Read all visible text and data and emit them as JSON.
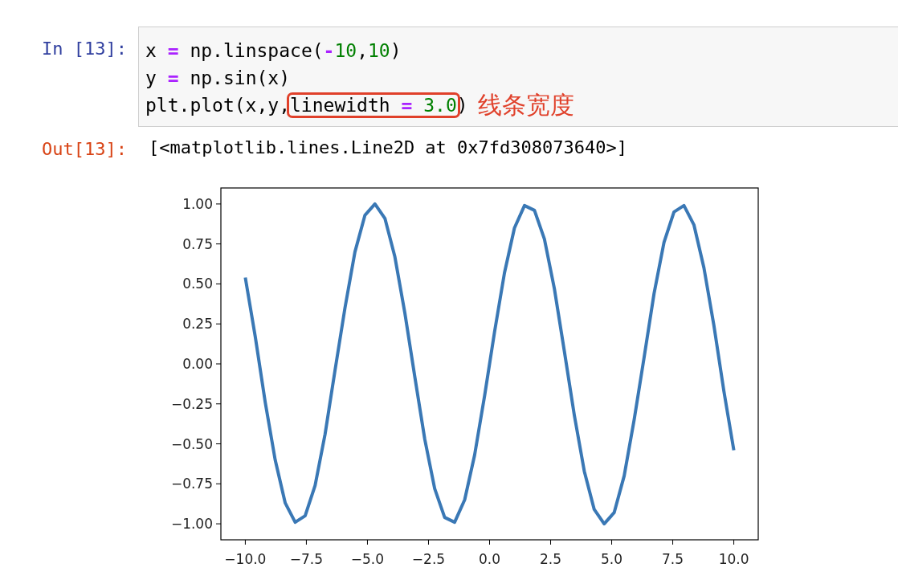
{
  "input_prompt": "In [13]:",
  "code_lines": [
    [
      {
        "kind": "text",
        "text": "x ",
        "boxed": false
      },
      {
        "kind": "op",
        "text": "=",
        "boxed": false
      },
      {
        "kind": "text",
        "text": " np.linspace(",
        "boxed": false
      },
      {
        "kind": "op",
        "text": "-",
        "boxed": false
      },
      {
        "kind": "num",
        "text": "10",
        "boxed": false
      },
      {
        "kind": "text",
        "text": ",",
        "boxed": false
      },
      {
        "kind": "num",
        "text": "10",
        "boxed": false
      },
      {
        "kind": "text",
        "text": ")",
        "boxed": false
      }
    ],
    [
      {
        "kind": "text",
        "text": "y ",
        "boxed": false
      },
      {
        "kind": "op",
        "text": "=",
        "boxed": false
      },
      {
        "kind": "text",
        "text": " np.sin(x)",
        "boxed": false
      }
    ],
    [
      {
        "kind": "text",
        "text": "plt.plot(x,y,",
        "boxed": false
      },
      {
        "kind": "text",
        "text": "linewidth ",
        "boxed": true
      },
      {
        "kind": "op",
        "text": "=",
        "boxed": true
      },
      {
        "kind": "num",
        "text": " 3.0",
        "boxed": true
      },
      {
        "kind": "text",
        "text": ")",
        "boxed": false
      }
    ]
  ],
  "annotation": {
    "text": "线条宽度"
  },
  "output_prompt": "Out[13]:",
  "output_text": "[<matplotlib.lines.Line2D at 0x7fd308073640>]",
  "chart_data": {
    "type": "line",
    "x": [
      -10,
      -9.592,
      -9.184,
      -8.776,
      -8.367,
      -7.959,
      -7.551,
      -7.143,
      -6.735,
      -6.327,
      -5.918,
      -5.51,
      -5.102,
      -4.694,
      -4.286,
      -3.878,
      -3.469,
      -3.061,
      -2.653,
      -2.245,
      -1.837,
      -1.429,
      -1.02,
      -0.612,
      -0.204,
      0.204,
      0.612,
      1.02,
      1.429,
      1.837,
      2.245,
      2.653,
      3.061,
      3.469,
      3.878,
      4.286,
      4.694,
      5.102,
      5.51,
      5.918,
      6.327,
      6.735,
      7.143,
      7.551,
      7.959,
      8.367,
      8.776,
      9.184,
      9.592,
      10
    ],
    "series": [
      {
        "color": "#3a78b5",
        "values": [
          0.54,
          0.17,
          -0.24,
          -0.6,
          -0.87,
          -0.99,
          -0.95,
          -0.76,
          -0.44,
          -0.04,
          0.35,
          0.7,
          0.93,
          1.0,
          0.91,
          0.67,
          0.32,
          -0.08,
          -0.47,
          -0.78,
          -0.96,
          -0.99,
          -0.85,
          -0.57,
          -0.2,
          0.2,
          0.57,
          0.85,
          0.99,
          0.96,
          0.78,
          0.47,
          0.08,
          -0.32,
          -0.67,
          -0.91,
          -1.0,
          -0.93,
          -0.7,
          -0.35,
          0.04,
          0.44,
          0.76,
          0.95,
          0.99,
          0.87,
          0.6,
          0.24,
          -0.17,
          -0.54
        ]
      }
    ],
    "xlim": [
      -11,
      11
    ],
    "ylim": [
      -1.1,
      1.1
    ],
    "xticks": [
      {
        "value": -10,
        "label": "−10.0"
      },
      {
        "value": -7.5,
        "label": "−7.5"
      },
      {
        "value": -5,
        "label": "−5.0"
      },
      {
        "value": -2.5,
        "label": "−2.5"
      },
      {
        "value": 0,
        "label": "0.0"
      },
      {
        "value": 2.5,
        "label": "2.5"
      },
      {
        "value": 5,
        "label": "5.0"
      },
      {
        "value": 7.5,
        "label": "7.5"
      },
      {
        "value": 10,
        "label": "10.0"
      }
    ],
    "yticks": [
      {
        "value": 1,
        "label": "1.00"
      },
      {
        "value": 0.75,
        "label": "0.75"
      },
      {
        "value": 0.5,
        "label": "0.50"
      },
      {
        "value": 0.25,
        "label": "0.25"
      },
      {
        "value": 0,
        "label": "0.00"
      },
      {
        "value": -0.25,
        "label": "−0.25"
      },
      {
        "value": -0.5,
        "label": "−0.50"
      },
      {
        "value": -0.75,
        "label": "−0.75"
      },
      {
        "value": -1,
        "label": "−1.00"
      }
    ]
  }
}
